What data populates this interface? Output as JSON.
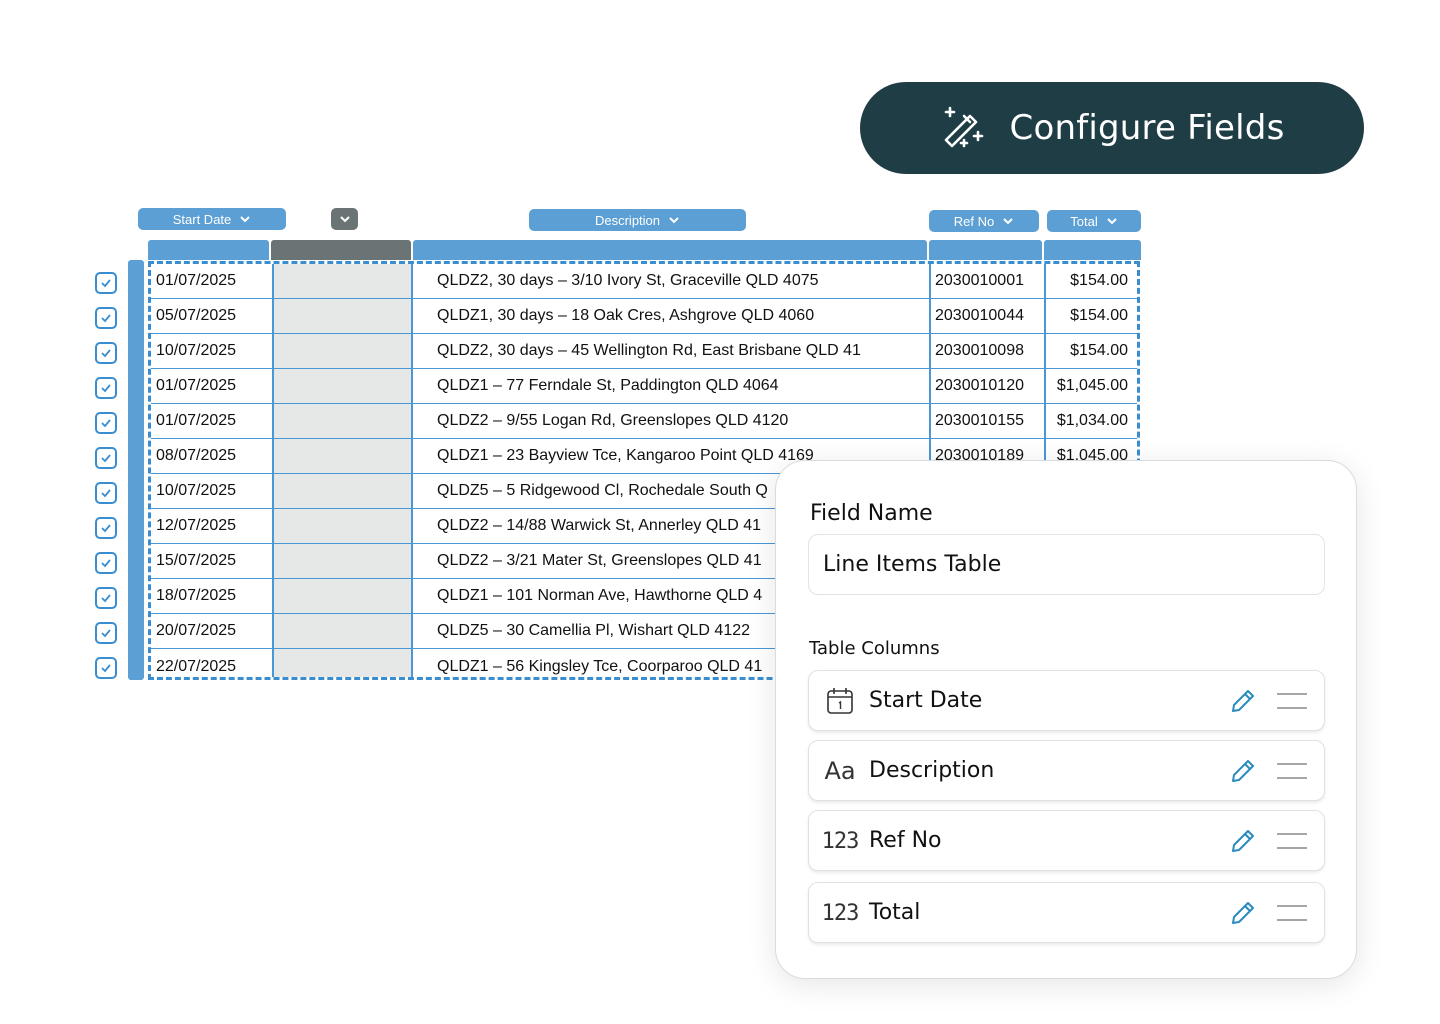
{
  "toolbar": {
    "configure_label": "Configure Fields",
    "configure_icon": "magic-wand-icon"
  },
  "column_chips": {
    "start_date": "Start Date",
    "unnamed": "",
    "description": "Description",
    "ref_no": "Ref No",
    "total": "Total"
  },
  "rows": [
    {
      "date": "01/07/2025",
      "desc": "QLDZ2, 30 days – 3/10 Ivory St, Graceville QLD 4075",
      "ref": "2030010001",
      "total": "$154.00"
    },
    {
      "date": "05/07/2025",
      "desc": "QLDZ1, 30 days – 18 Oak Cres, Ashgrove QLD 4060",
      "ref": "2030010044",
      "total": "$154.00"
    },
    {
      "date": "10/07/2025",
      "desc": "QLDZ2, 30 days – 45 Wellington Rd, East Brisbane QLD 41",
      "ref": "2030010098",
      "total": "$154.00"
    },
    {
      "date": "01/07/2025",
      "desc": "QLDZ1 – 77 Ferndale St, Paddington QLD 4064",
      "ref": "2030010120",
      "total": "$1,045.00"
    },
    {
      "date": "01/07/2025",
      "desc": "QLDZ2 – 9/55 Logan Rd, Greenslopes QLD 4120",
      "ref": "2030010155",
      "total": "$1,034.00"
    },
    {
      "date": "08/07/2025",
      "desc": "QLDZ1 – 23 Bayview Tce, Kangaroo Point QLD 4169",
      "ref": "2030010189",
      "total": "$1,045.00"
    },
    {
      "date": "10/07/2025",
      "desc": "QLDZ5 – 5 Ridgewood Cl, Rochedale South Q",
      "ref": "",
      "total": ""
    },
    {
      "date": "12/07/2025",
      "desc": "QLDZ2 – 14/88 Warwick St, Annerley QLD 41",
      "ref": "",
      "total": ""
    },
    {
      "date": "15/07/2025",
      "desc": "QLDZ2 – 3/21 Mater St, Greenslopes QLD 41",
      "ref": "",
      "total": ""
    },
    {
      "date": "18/07/2025",
      "desc": "QLDZ1 – 101 Norman Ave, Hawthorne QLD 4",
      "ref": "",
      "total": ""
    },
    {
      "date": "20/07/2025",
      "desc": "QLDZ5 – 30 Camellia Pl, Wishart QLD 4122",
      "ref": "",
      "total": ""
    },
    {
      "date": "22/07/2025",
      "desc": "QLDZ1 – 56 Kingsley Tce, Coorparoo QLD 41",
      "ref": "",
      "total": ""
    }
  ],
  "panel": {
    "field_name_label": "Field Name",
    "field_name_value": "Line Items Table",
    "table_columns_label": "Table Columns",
    "columns": [
      {
        "name": "Start Date",
        "icon": "calendar-icon",
        "icon_text": ""
      },
      {
        "name": "Description",
        "icon": "text-type-icon",
        "icon_text": "Aa"
      },
      {
        "name": "Ref No",
        "icon": "number-type-icon",
        "icon_text": "123"
      },
      {
        "name": "Total",
        "icon": "number-type-icon",
        "icon_text": "123"
      }
    ]
  },
  "colors": {
    "accent": "#5b9fd4",
    "dark": "#1e3d45",
    "border": "#3a8ed0"
  }
}
